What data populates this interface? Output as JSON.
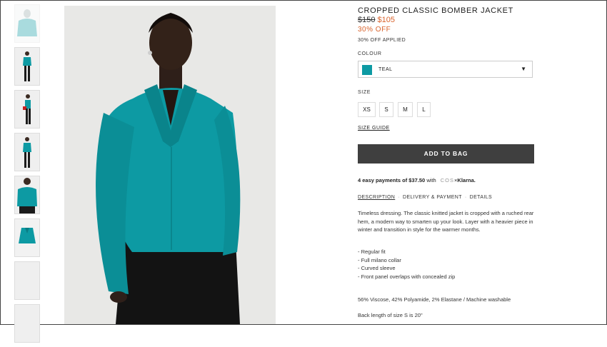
{
  "product": {
    "title": "CROPPED CLASSIC BOMBER JACKET",
    "price_old": "$150",
    "price_new": "$105",
    "discount": "30% OFF",
    "discount_applied": "30% OFF APPLIED"
  },
  "colour": {
    "label": "COLOUR",
    "selected": "TEAL",
    "swatch_color": "#0d9aa3"
  },
  "size": {
    "label": "SIZE",
    "options": [
      "XS",
      "S",
      "M",
      "L"
    ],
    "guide": "SIZE GUIDE"
  },
  "cart": {
    "add_label": "ADD TO BAG"
  },
  "payments": {
    "text_bold": "4 easy payments of $37.50",
    "text_with": "with",
    "cos": "COS",
    "x": "×",
    "klarna": "Klarna."
  },
  "tabs": [
    "DESCRIPTION",
    "DELIVERY & PAYMENT",
    "DETAILS"
  ],
  "tab_separator": "·",
  "description": "Timeless dressing. The classic knitted jacket is cropped with a ruched rear hem, a modern way to smarten up your look. Layer with a heavier piece in winter and transition in style for the warmer months.",
  "features": [
    "- Regular fit",
    "- Full milano collar",
    "- Curved sleeve",
    "- Front panel overlaps with concealed zip"
  ],
  "material": "56% Viscose, 42% Polyamide, 2% Elastane / Machine washable",
  "length": "Back length of size S is 20\"",
  "colors": {
    "accent": "#d9622b",
    "button": "#3f3f3f",
    "teal": "#0d9aa3"
  }
}
